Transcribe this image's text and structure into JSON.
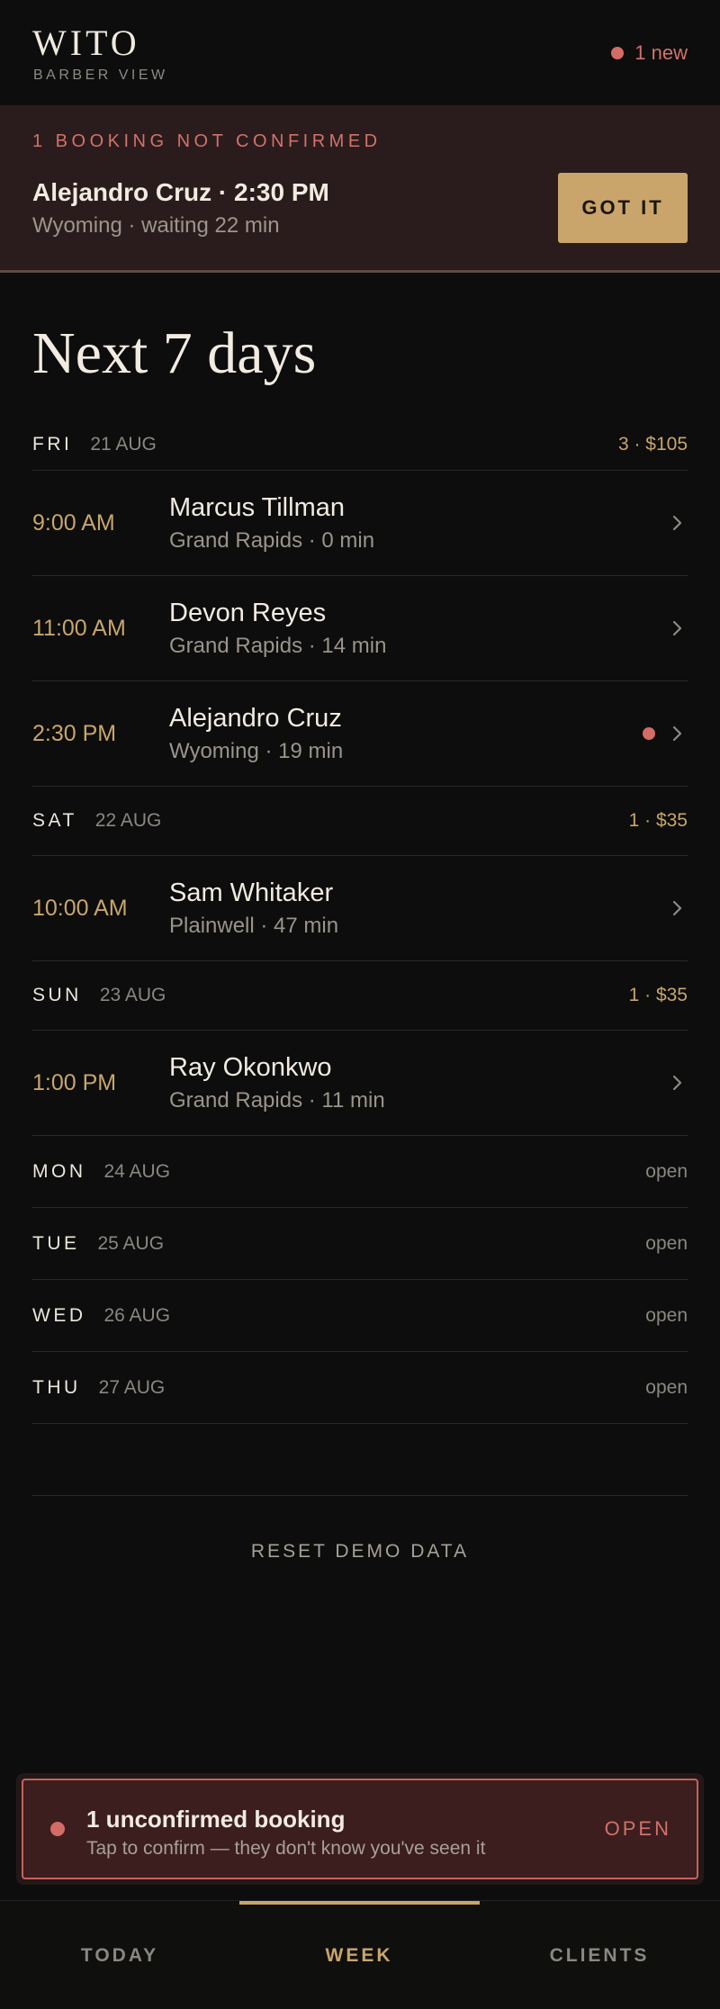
{
  "header": {
    "logo": "WITO",
    "subtitle": "BARBER VIEW",
    "new_count": "1 new"
  },
  "alert": {
    "kicker": "1 BOOKING NOT CONFIRMED",
    "title": "Alejandro Cruz · 2:30 PM",
    "subtitle": "Wyoming · waiting 22 min",
    "button": "GOT IT"
  },
  "main": {
    "title": "Next 7 days",
    "days": [
      {
        "name": "FRI",
        "date": "21 AUG",
        "summary": "3 · $105",
        "bookings": [
          {
            "time": "9:00 AM",
            "name": "Marcus Tillman",
            "meta": "Grand Rapids · 0 min",
            "unconfirmed": false
          },
          {
            "time": "11:00 AM",
            "name": "Devon Reyes",
            "meta": "Grand Rapids · 14 min",
            "unconfirmed": false
          },
          {
            "time": "2:30 PM",
            "name": "Alejandro Cruz",
            "meta": "Wyoming · 19 min",
            "unconfirmed": true
          }
        ]
      },
      {
        "name": "SAT",
        "date": "22 AUG",
        "summary": "1 · $35",
        "bookings": [
          {
            "time": "10:00 AM",
            "name": "Sam Whitaker",
            "meta": "Plainwell · 47 min",
            "unconfirmed": false
          }
        ]
      },
      {
        "name": "SUN",
        "date": "23 AUG",
        "summary": "1 · $35",
        "bookings": [
          {
            "time": "1:00 PM",
            "name": "Ray Okonkwo",
            "meta": "Grand Rapids · 11 min",
            "unconfirmed": false
          }
        ]
      },
      {
        "name": "MON",
        "date": "24 AUG",
        "summary": "open",
        "bookings": []
      },
      {
        "name": "TUE",
        "date": "25 AUG",
        "summary": "open",
        "bookings": []
      },
      {
        "name": "WED",
        "date": "26 AUG",
        "summary": "open",
        "bookings": []
      },
      {
        "name": "THU",
        "date": "27 AUG",
        "summary": "open",
        "bookings": []
      }
    ],
    "reset_label": "RESET DEMO DATA"
  },
  "toast": {
    "title": "1 unconfirmed booking",
    "subtitle": "Tap to confirm — they don't know you've seen it",
    "action": "OPEN"
  },
  "nav": {
    "items": [
      "TODAY",
      "WEEK",
      "CLIENTS"
    ],
    "active": "WEEK"
  },
  "colors": {
    "accent": "#c9a56b",
    "alert": "#d46c66",
    "background": "#0c0d0c"
  }
}
